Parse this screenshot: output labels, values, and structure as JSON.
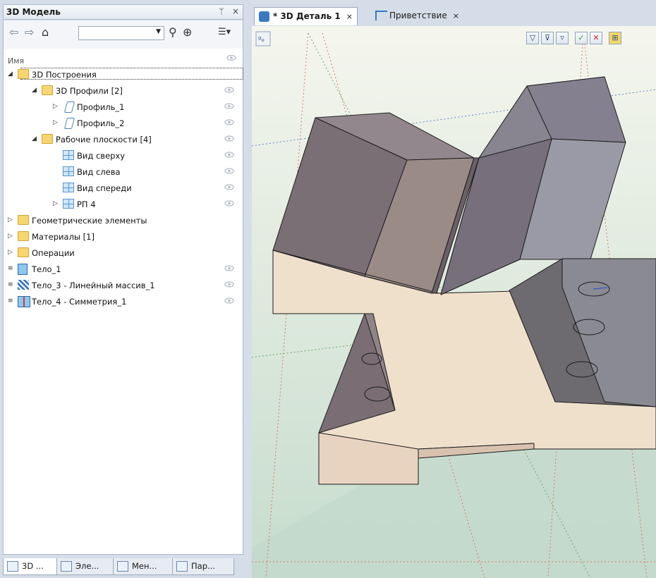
{
  "panel": {
    "title": "3D Модель",
    "pin_glyph": "ᛘ",
    "close_glyph": "×",
    "column_name": "Имя",
    "toolbar": {
      "back_icon": "arrow-left-icon",
      "forward_icon": "arrow-right-icon",
      "home_icon": "home-icon",
      "search_icon": "search-icon",
      "target_icon": "crosshair-icon",
      "list_icon": "list-menu-icon",
      "combo_value": ""
    }
  },
  "tree": [
    {
      "label": "3D Построения",
      "level": 0,
      "expander": "◢",
      "icon": "folder",
      "selected": true,
      "eye": false
    },
    {
      "label": "3D Профили [2]",
      "level": 1,
      "expander": "◢",
      "icon": "folder",
      "eye": true
    },
    {
      "label": "Профиль_1",
      "level": 2,
      "expander": "▷",
      "icon": "profile",
      "eye": true
    },
    {
      "label": "Профиль_2",
      "level": 2,
      "expander": "▷",
      "icon": "profile",
      "eye": true
    },
    {
      "label": "Рабочие плоскости [4]",
      "level": 1,
      "expander": "◢",
      "icon": "folder",
      "eye": true
    },
    {
      "label": "Вид сверху",
      "level": 2,
      "expander": "",
      "icon": "plane",
      "eye": true
    },
    {
      "label": "Вид слева",
      "level": 2,
      "expander": "",
      "icon": "plane",
      "eye": true
    },
    {
      "label": "Вид спереди",
      "level": 2,
      "expander": "",
      "icon": "plane",
      "eye": true
    },
    {
      "label": "РП 4",
      "level": 2,
      "expander": "▷",
      "icon": "plane",
      "eye": true
    },
    {
      "label": "Геометрические элементы",
      "level": 0,
      "expander": "▷",
      "icon": "folder",
      "eye": false
    },
    {
      "label": "Материалы [1]",
      "level": 0,
      "expander": "▷",
      "icon": "folder",
      "eye": false
    },
    {
      "label": "Операции",
      "level": 0,
      "expander": "▷",
      "icon": "folder",
      "eye": false
    },
    {
      "label": "Тело_1",
      "level": 0,
      "expander": "≡",
      "icon": "body",
      "eye": true
    },
    {
      "label": "Тело_3 - Линейный массив_1",
      "level": 0,
      "expander": "≡",
      "icon": "array",
      "eye": true
    },
    {
      "label": "Тело_4 - Симметрия_1",
      "level": 0,
      "expander": "≡",
      "icon": "mirror",
      "eye": true
    }
  ],
  "bottom_tabs": [
    {
      "label": "3D ...",
      "active": true,
      "icon": "model-tab-icon"
    },
    {
      "label": "Эле...",
      "active": false,
      "icon": "elements-tab-icon"
    },
    {
      "label": "Мен...",
      "active": false,
      "icon": "manager-tab-icon"
    },
    {
      "label": "Пар...",
      "active": false,
      "icon": "parameters-tab-icon"
    }
  ],
  "doc_tabs": [
    {
      "label": "* 3D Деталь 1",
      "close": "×",
      "active": true,
      "icon": "part-doc-icon"
    },
    {
      "label": "Приветствие",
      "close": "×",
      "active": false,
      "icon": "flag-icon"
    }
  ],
  "viewport_buttons": [
    "filter-icon",
    "filter-frame-icon",
    "filter-list-icon",
    "filter-check-icon",
    "filter-cross-icon",
    "view-layout-icon"
  ],
  "colors": {
    "accent": "#3b78c2",
    "folder": "#f8d570",
    "part_face": "#efe0cc",
    "side_face": "#7a6e74"
  }
}
